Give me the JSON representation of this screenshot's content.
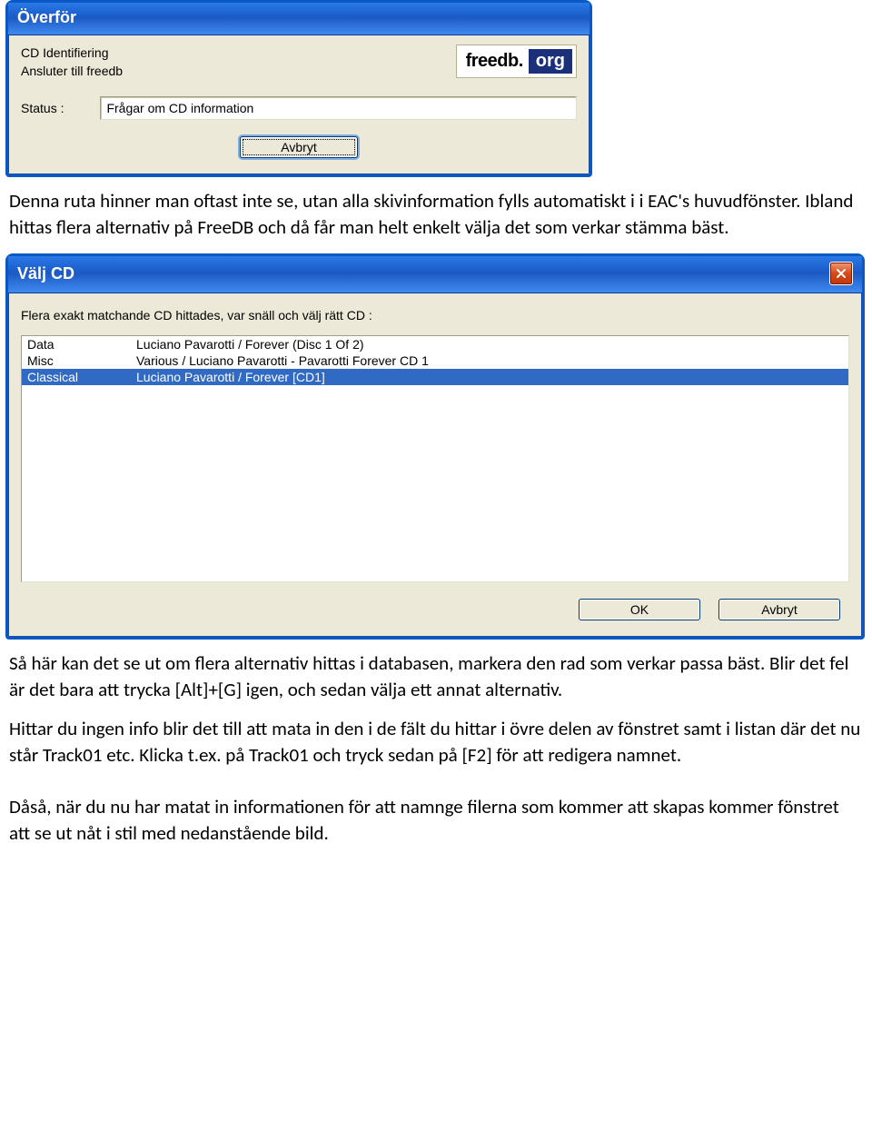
{
  "window1": {
    "title": "Överför",
    "line1": "CD Identifiering",
    "line2": "Ansluter till freedb",
    "status_label": "Status :",
    "status_value": "Frågar om CD information",
    "logo_left": "freedb.",
    "logo_right": "org",
    "cancel": "Avbryt"
  },
  "para1": "Denna ruta hinner man oftast inte se, utan alla skivinformation fylls automatiskt i i EAC's huvudfönster. Ibland hittas flera alternativ på FreeDB och då får man helt enkelt välja det som verkar stämma bäst.",
  "window2": {
    "title": "Välj CD",
    "prompt": "Flera exakt matchande CD hittades, var snäll och välj rätt CD :",
    "rows": [
      {
        "cat": "Data",
        "title": "Luciano Pavarotti / Forever (Disc 1 Of 2)"
      },
      {
        "cat": "Misc",
        "title": "Various / Luciano Pavarotti - Pavarotti Forever CD 1"
      },
      {
        "cat": "Classical",
        "title": "Luciano Pavarotti / Forever [CD1]"
      }
    ],
    "ok": "OK",
    "cancel": "Avbryt"
  },
  "para2": "Så här kan det se ut om flera alternativ hittas i databasen, markera den rad som verkar passa bäst. Blir det fel är det bara att trycka [Alt]+[G] igen, och sedan välja ett annat alternativ.",
  "para3": "Hittar du ingen info blir det till att mata in den i de fält du hittar i övre delen av fönstret samt i listan där det nu står Track01 etc.  Klicka t.ex. på Track01 och tryck sedan på [F2] för att redigera namnet.",
  "para4": "Dåså, när du nu har matat in informationen för att namnge filerna som kommer att skapas kommer fönstret att se ut nåt i stil med nedanstående bild."
}
